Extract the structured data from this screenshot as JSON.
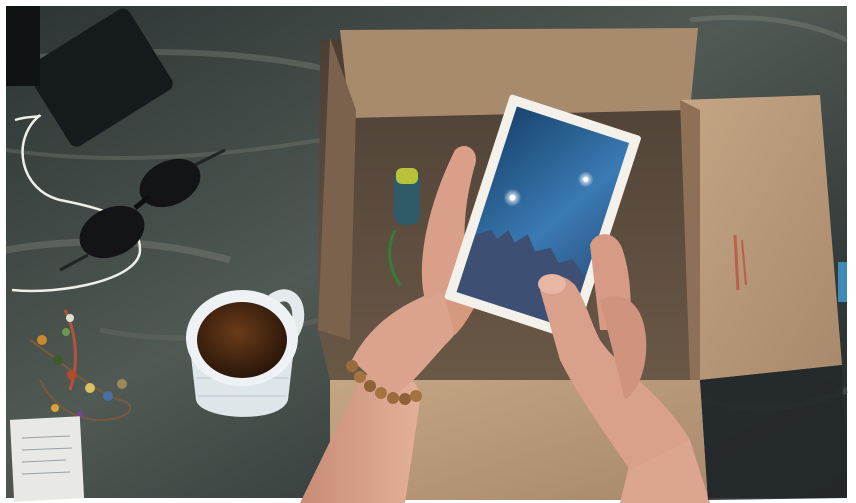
{
  "scene": {
    "colors": {
      "table_dark": "#1d2427",
      "table_mid": "#3c4647",
      "table_light": "#6d716a",
      "cardboard": "#b69676",
      "cardboard_dark": "#6f5742",
      "box_interior": "#53463b",
      "postcard_border": "#f4f1ea",
      "postcard_sky_top": "#1f4d74",
      "postcard_sky_mid": "#3b7bb0",
      "postcard_mountain": "#3e4f74",
      "tea": "#4a2a12",
      "mug": "#e9eef0",
      "skin": "#d9a08b",
      "skin_shadow": "#b77e6b",
      "bead": "#9b6b3e",
      "cable": "#efefea",
      "sunglasses": "#141617"
    }
  }
}
